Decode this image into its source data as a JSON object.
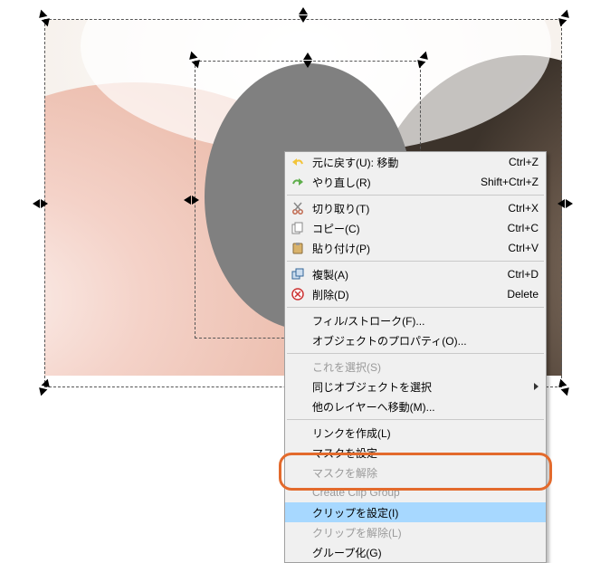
{
  "selection": {
    "outer": "image-selection",
    "inner": "circle-selection"
  },
  "menu": {
    "items": [
      {
        "key": "undo",
        "label": "元に戻す(U): 移動",
        "shortcut": "Ctrl+Z",
        "icon": "undo",
        "enabled": true
      },
      {
        "key": "redo",
        "label": "やり直し(R)",
        "shortcut": "Shift+Ctrl+Z",
        "icon": "redo",
        "enabled": true
      },
      {
        "sep": true
      },
      {
        "key": "cut",
        "label": "切り取り(T)",
        "shortcut": "Ctrl+X",
        "icon": "cut",
        "enabled": true
      },
      {
        "key": "copy",
        "label": "コピー(C)",
        "shortcut": "Ctrl+C",
        "icon": "copy",
        "enabled": true
      },
      {
        "key": "paste",
        "label": "貼り付け(P)",
        "shortcut": "Ctrl+V",
        "icon": "paste",
        "enabled": true
      },
      {
        "sep": true
      },
      {
        "key": "duplicate",
        "label": "複製(A)",
        "shortcut": "Ctrl+D",
        "icon": "duplicate",
        "enabled": true
      },
      {
        "key": "delete",
        "label": "削除(D)",
        "shortcut": "Delete",
        "icon": "delete",
        "enabled": true
      },
      {
        "sep": true
      },
      {
        "key": "fillstroke",
        "label": "フィル/ストローク(F)...",
        "shortcut": "",
        "icon": "",
        "enabled": true
      },
      {
        "key": "objprops",
        "label": "オブジェクトのプロパティ(O)...",
        "shortcut": "",
        "icon": "",
        "enabled": true
      },
      {
        "sep": true
      },
      {
        "key": "selectthis",
        "label": "これを選択(S)",
        "shortcut": "",
        "icon": "",
        "enabled": false
      },
      {
        "key": "selectsame",
        "label": "同じオブジェクトを選択",
        "shortcut": "",
        "icon": "",
        "enabled": true,
        "submenu": true
      },
      {
        "key": "movelayer",
        "label": "他のレイヤーへ移動(M)...",
        "shortcut": "",
        "icon": "",
        "enabled": true
      },
      {
        "sep": true
      },
      {
        "key": "makelink",
        "label": "リンクを作成(L)",
        "shortcut": "",
        "icon": "",
        "enabled": true
      },
      {
        "key": "setmask",
        "label": "マスクを設定",
        "shortcut": "",
        "icon": "",
        "enabled": true
      },
      {
        "key": "releasemask",
        "label": "マスクを解除",
        "shortcut": "",
        "icon": "",
        "enabled": false
      },
      {
        "key": "clipgroup",
        "label": "Create Clip Group",
        "shortcut": "",
        "icon": "",
        "enabled": false
      },
      {
        "key": "setclip",
        "label": "クリップを設定(I)",
        "shortcut": "",
        "icon": "",
        "enabled": true,
        "highlight": true
      },
      {
        "key": "releaseclip",
        "label": "クリップを解除(L)",
        "shortcut": "",
        "icon": "",
        "enabled": false
      },
      {
        "key": "group",
        "label": "グループ化(G)",
        "shortcut": "",
        "icon": "",
        "enabled": true
      }
    ]
  }
}
